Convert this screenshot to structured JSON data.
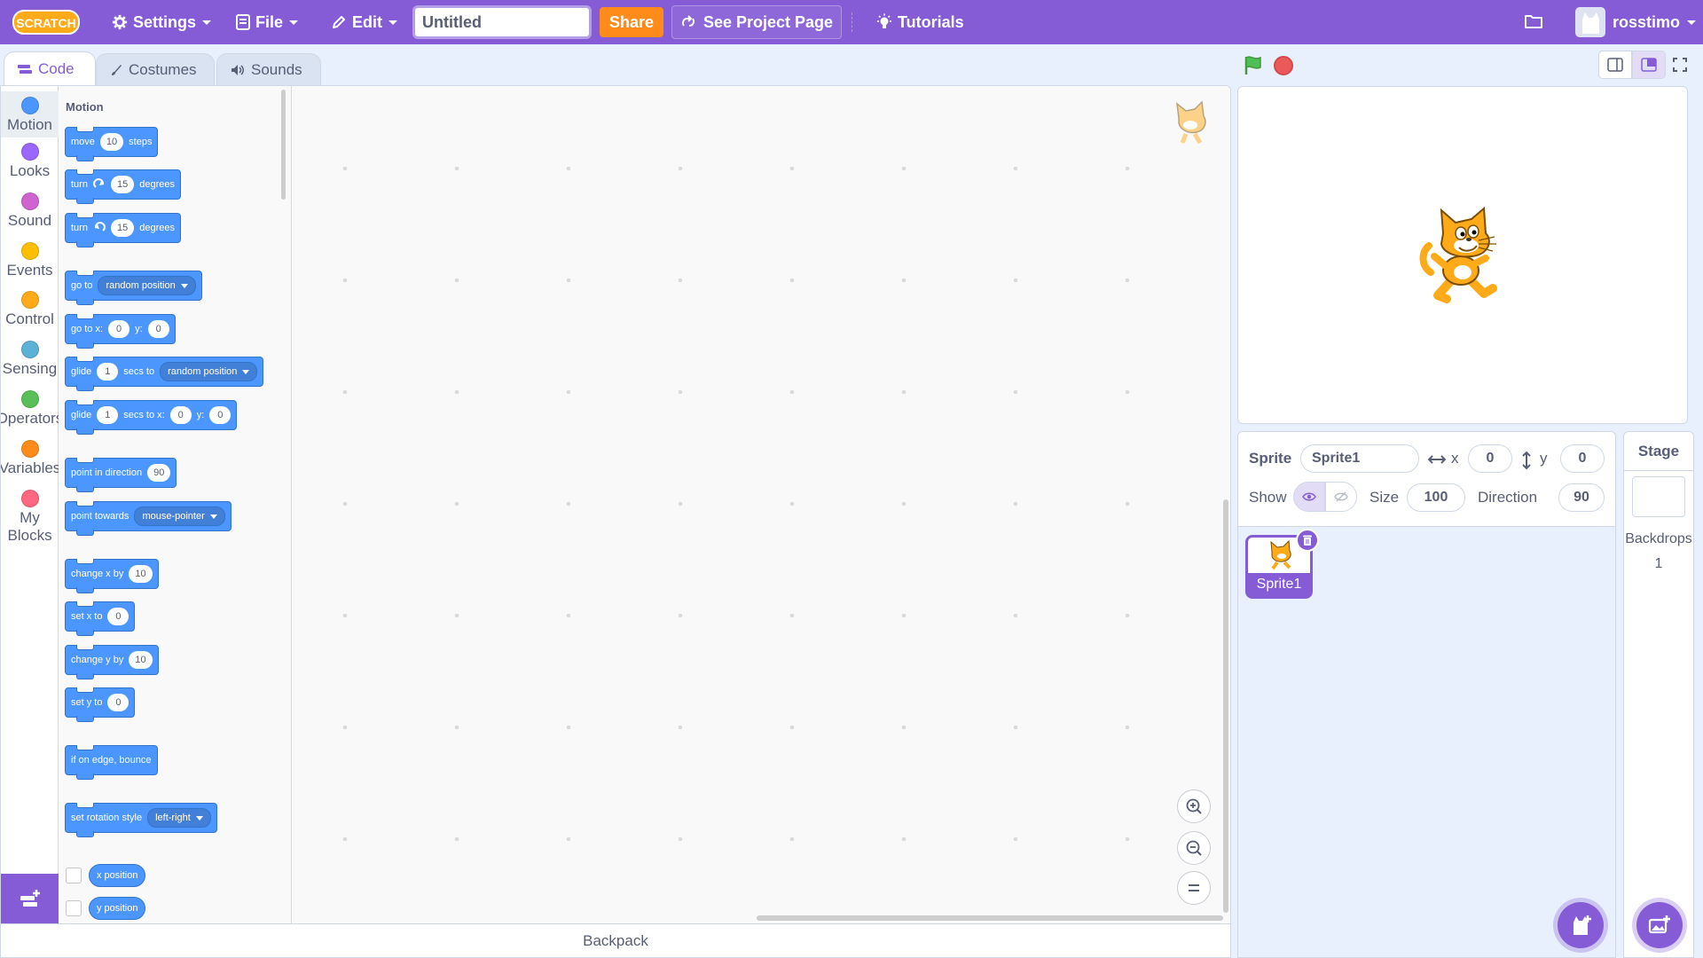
{
  "menu": {
    "logo_text": "SCRATCH",
    "settings_label": "Settings",
    "file_label": "File",
    "edit_label": "Edit",
    "project_title": "Untitled",
    "share_label": "Share",
    "see_project_label": "See Project Page",
    "tutorials_label": "Tutorials",
    "username": "rosstimo"
  },
  "tabs": {
    "code": "Code",
    "costumes": "Costumes",
    "sounds": "Sounds"
  },
  "categories": [
    {
      "label": "Motion",
      "color": "#4c97ff"
    },
    {
      "label": "Looks",
      "color": "#9966ff"
    },
    {
      "label": "Sound",
      "color": "#cf63cf"
    },
    {
      "label": "Events",
      "color": "#ffbf00"
    },
    {
      "label": "Control",
      "color": "#ffab19"
    },
    {
      "label": "Sensing",
      "color": "#5cb1d6"
    },
    {
      "label": "Operators",
      "color": "#59c059"
    },
    {
      "label": "Variables",
      "color": "#ff8c1a"
    },
    {
      "label": "My Blocks",
      "color": "#ff6680"
    }
  ],
  "palette": {
    "section_title": "Motion",
    "move": {
      "pre": "move",
      "val": "10",
      "post": "steps"
    },
    "turn_right": {
      "pre": "turn",
      "val": "15",
      "post": "degrees"
    },
    "turn_left": {
      "pre": "turn",
      "val": "15",
      "post": "degrees"
    },
    "go_to": {
      "pre": "go to",
      "dd": "random position"
    },
    "go_to_xy": {
      "pre": "go to x:",
      "x": "0",
      "mid": "y:",
      "y": "0"
    },
    "glide_to": {
      "pre": "glide",
      "val": "1",
      "mid": "secs to",
      "dd": "random position"
    },
    "glide_xy": {
      "pre": "glide",
      "val": "1",
      "mid": "secs to x:",
      "x": "0",
      "mid2": "y:",
      "y": "0"
    },
    "point_dir": {
      "pre": "point in direction",
      "val": "90"
    },
    "point_towards": {
      "pre": "point towards",
      "dd": "mouse-pointer"
    },
    "change_x": {
      "pre": "change x by",
      "val": "10"
    },
    "set_x": {
      "pre": "set x to",
      "val": "0"
    },
    "change_y": {
      "pre": "change y by",
      "val": "10"
    },
    "set_y": {
      "pre": "set y to",
      "val": "0"
    },
    "bounce": {
      "pre": "if on edge, bounce"
    },
    "rotation": {
      "pre": "set rotation style",
      "dd": "left-right"
    },
    "x_position": "x position",
    "y_position": "y position"
  },
  "backpack_label": "Backpack",
  "sprite_info": {
    "sprite_label": "Sprite",
    "sprite_name": "Sprite1",
    "x_label": "x",
    "x_value": "0",
    "y_label": "y",
    "y_value": "0",
    "show_label": "Show",
    "size_label": "Size",
    "size_value": "100",
    "direction_label": "Direction",
    "direction_value": "90"
  },
  "sprites": [
    {
      "name": "Sprite1"
    }
  ],
  "stage_panel": {
    "title": "Stage",
    "backdrops_label": "Backdrops",
    "backdrops_count": "1"
  },
  "colors": {
    "accent": "#855cd6",
    "motion": "#4c97ff",
    "share": "#ff8c1a",
    "stop": "#ec5959",
    "flag": "#4cbf56"
  }
}
